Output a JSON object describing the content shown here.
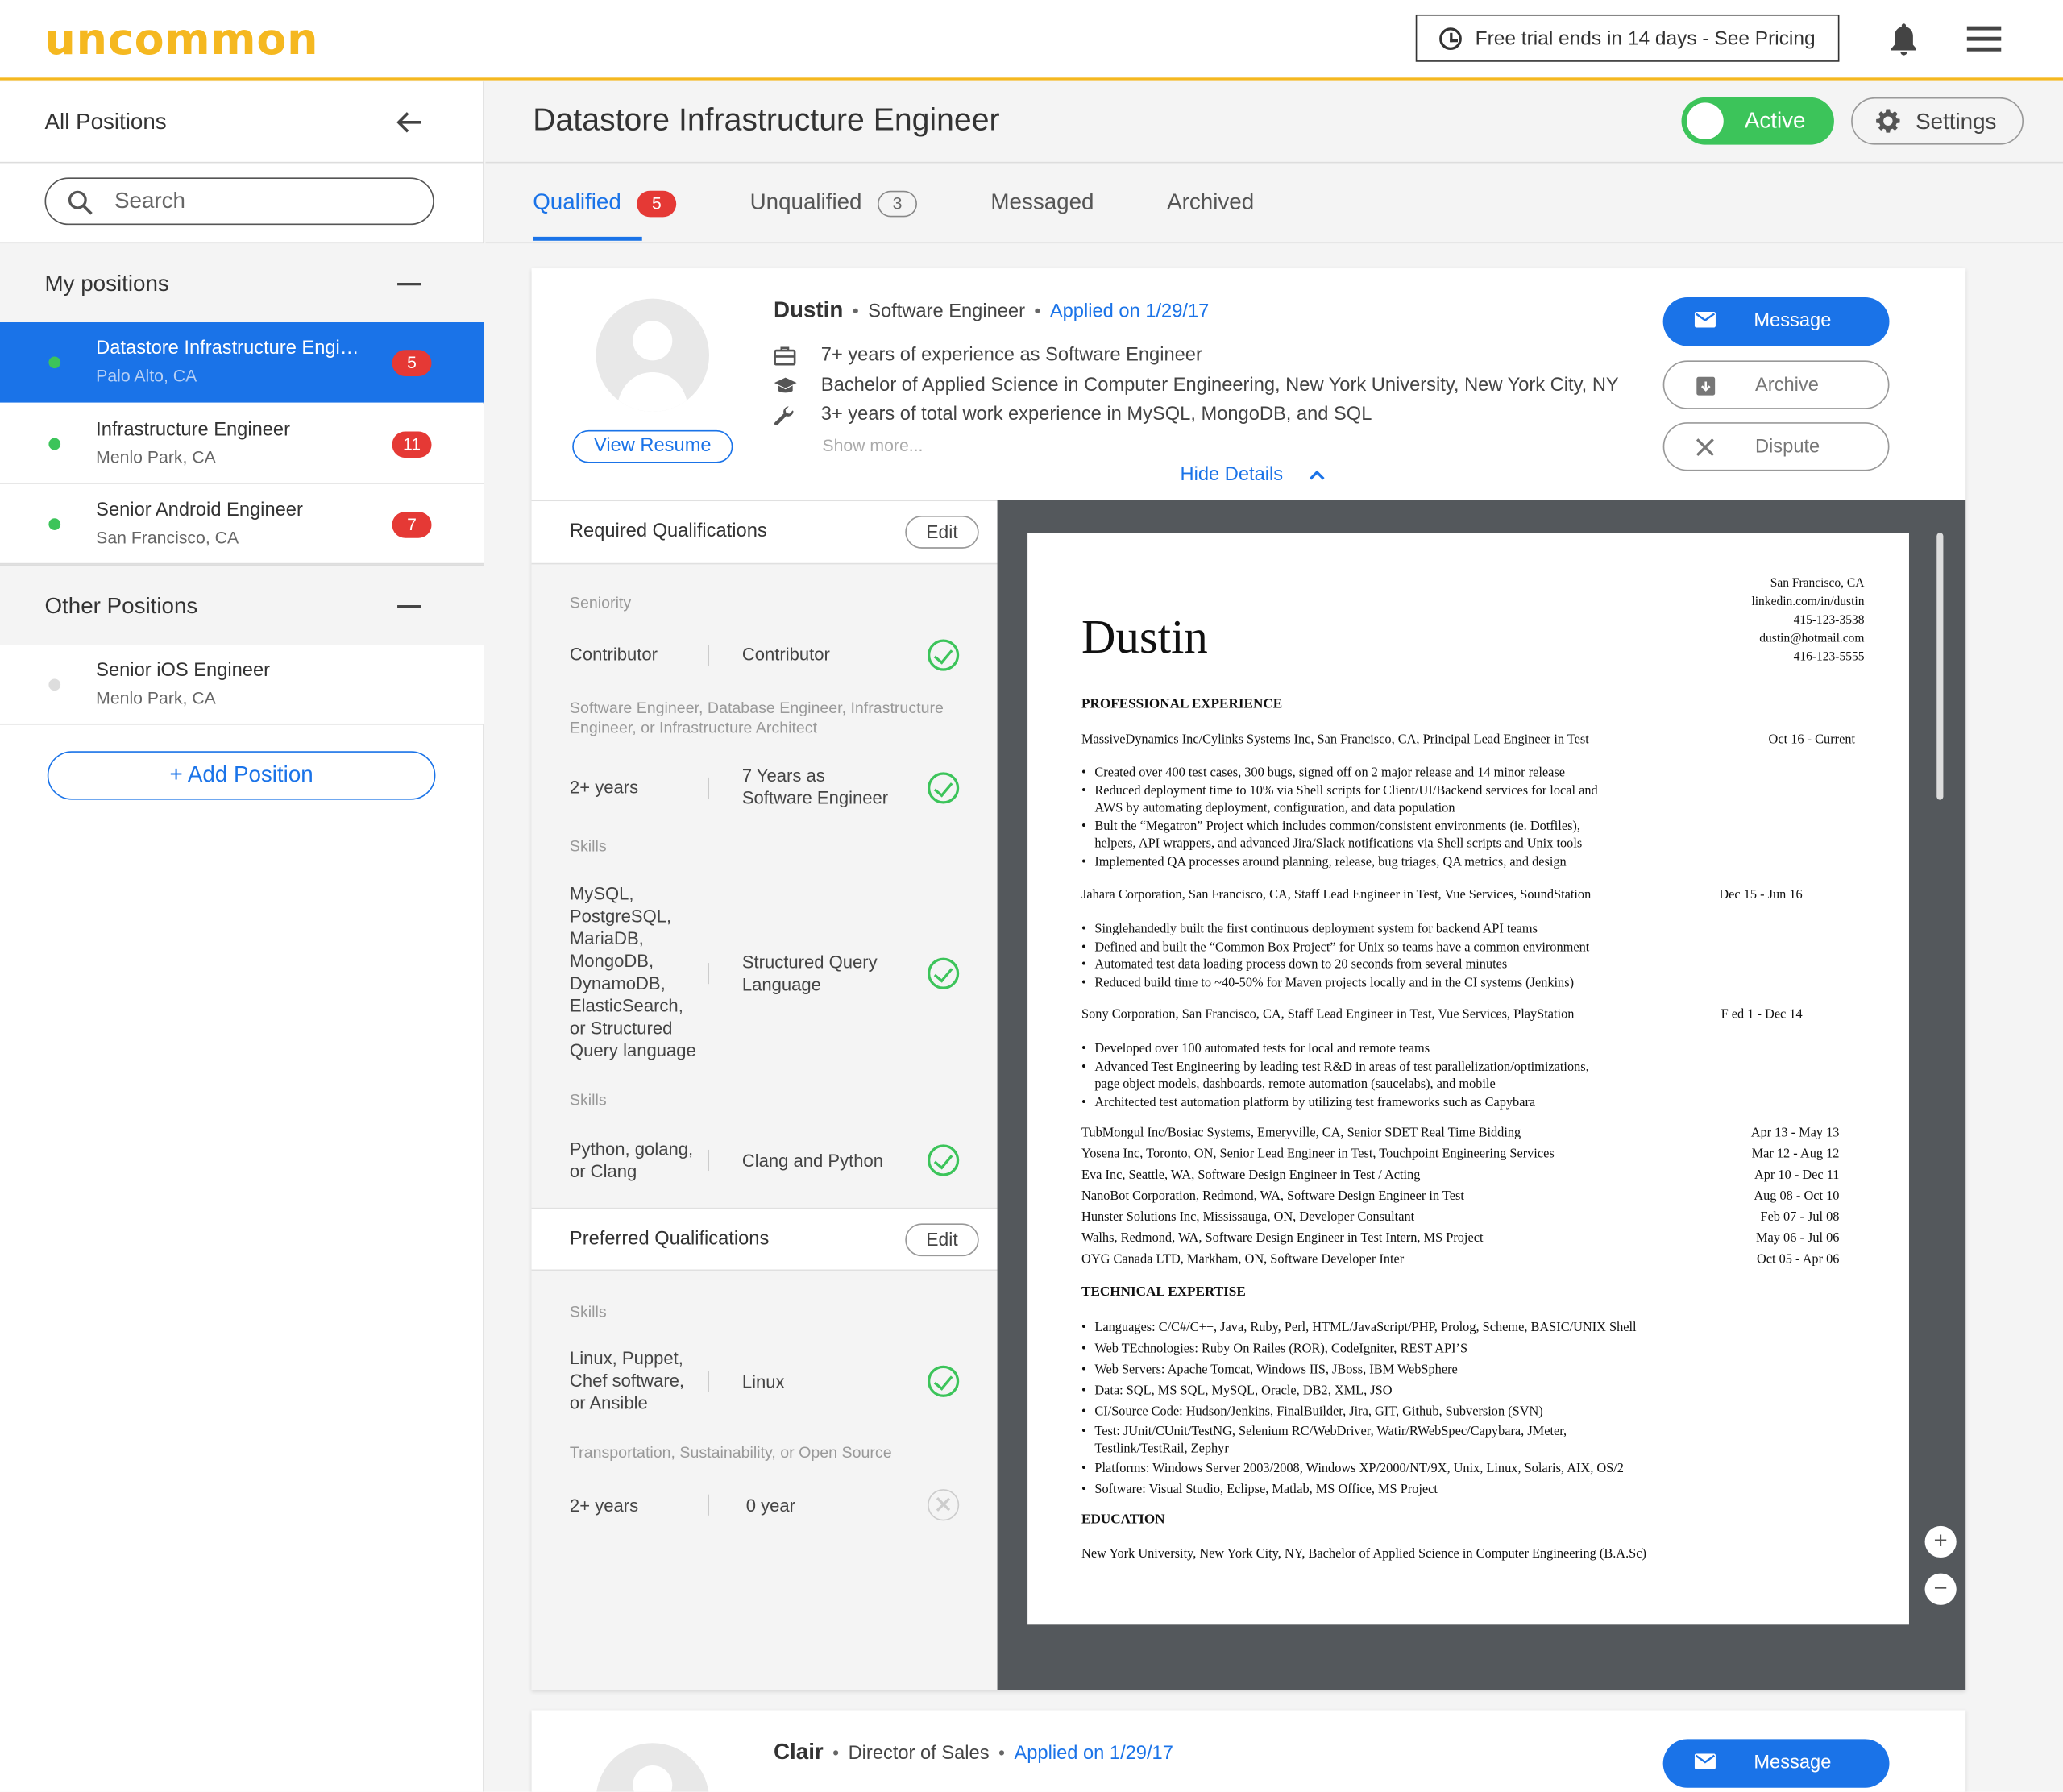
{
  "app": {
    "logo": "uncommon",
    "trial_text": "Free trial ends in 14 days - See Pricing",
    "accent_color": "#f5b820",
    "primary_color": "#1a73e8"
  },
  "sidebar": {
    "header": "All Positions",
    "search_placeholder": "Search",
    "my_positions_label": "My positions",
    "other_positions_label": "Other Positions",
    "my_positions": [
      {
        "name": "Datastore Infrastructure Engineer",
        "location": "Palo Alto, CA",
        "count": "5",
        "active": true
      },
      {
        "name": "Infrastructure Engineer",
        "location": "Menlo Park, CA",
        "count": "11",
        "active": true
      },
      {
        "name": "Senior Android Engineer",
        "location": "San Francisco, CA",
        "count": "7",
        "active": true
      }
    ],
    "other_positions": [
      {
        "name": "Senior iOS Engineer",
        "location": "Menlo Park, CA",
        "active": false
      }
    ],
    "add_position": "+ Add Position"
  },
  "main": {
    "title": "Datastore Infrastructure Engineer",
    "status_toggle": "Active",
    "settings_label": "Settings",
    "tabs": [
      {
        "label": "Qualified",
        "count": "5"
      },
      {
        "label": "Unqualified",
        "count": "3"
      },
      {
        "label": "Messaged"
      },
      {
        "label": "Archived"
      }
    ]
  },
  "candidate": {
    "name": "Dustin",
    "role": "Software Engineer",
    "applied": "Applied on 1/29/17",
    "view_resume": "View Resume",
    "details": [
      "7+ years of experience as Software Engineer",
      "Bachelor of Applied Science in Computer Engineering, New York University, New York City, NY",
      "3+ years of total work experience in MySQL, MongoDB, and SQL"
    ],
    "show_more": "Show more...",
    "hide_details": "Hide Details",
    "actions": {
      "message": "Message",
      "archive": "Archive",
      "dispute": "Dispute"
    }
  },
  "qualifications": {
    "required_title": "Required Qualifications",
    "preferred_title": "Preferred Qualifications",
    "edit_label": "Edit",
    "required": [
      {
        "label": "Seniority",
        "requirement": "Contributor",
        "candidate": "Contributor",
        "met": true
      },
      {
        "label": "Software Engineer, Database Engineer, Infrastructure Engineer, or Infrastructure Architect",
        "requirement": "2+ years",
        "candidate": "7 Years as Software Engineer",
        "met": true
      },
      {
        "label": "Skills",
        "requirement": "MySQL, PostgreSQL, MariaDB, MongoDB, DynamoDB, ElasticSearch, or Structured Query language",
        "candidate": "Structured Query Language",
        "met": true
      },
      {
        "label": "Skills",
        "requirement": "Python, golang, or Clang",
        "candidate": "Clang and Python",
        "met": true
      }
    ],
    "preferred": [
      {
        "label": "Skills",
        "requirement": "Linux, Puppet, Chef software, or Ansible",
        "candidate": "Linux",
        "met": true
      },
      {
        "label": "Transportation, Sustainability, or Open Source",
        "requirement": "2+ years",
        "candidate": "0 year",
        "met": false
      }
    ]
  },
  "resume": {
    "name": "Dustin",
    "contact": [
      "San Francisco, CA",
      "linkedin.com/in/dustin",
      "415-123-3538",
      "dustin@hotmail.com",
      "416-123-5555"
    ],
    "experience_title": "PROFESSIONAL EXPERIENCE",
    "jobs": [
      {
        "title": "MassiveDynamics Inc/Cylinks Systems Inc, San Francisco, CA, Principal Lead Engineer in Test",
        "dates": "Oct 16 - Current",
        "bullets": [
          "Created over 400 test cases, 300 bugs, signed off on 2 major release and 14 minor release",
          "Reduced deployment time to 10% via Shell scripts for Client/UI/Backend services for local and",
          "AWS by automating deployment, configuration, and data population",
          "Bult the “Megatron” Project which includes common/consistent environments (ie. Dotfiles),",
          "helpers, API wrappers, and advanced Jira/Slack notifications via Shell scripts and Unix tools",
          "Implemented QA processes around planning, release, bug triages, QA metrics, and design"
        ]
      },
      {
        "title": "Jahara Corporation, San Francisco, CA, Staff Lead Engineer in Test, Vue Services, SoundStation",
        "dates": "Dec 15 - Jun 16",
        "bullets": [
          "Singlehandedly built the first continuous deployment system for backend API teams",
          "Defined and built the “Common Box Project” for Unix so teams have a common environment",
          "Automated test data loading process down to 20 seconds from several minutes",
          "Reduced build time to ~40-50% for Maven projects locally and in the CI systems (Jenkins)"
        ]
      },
      {
        "title": "Sony Corporation, San Francisco, CA, Staff Lead Engineer in Test, Vue Services, PlayStation",
        "dates": "F ed 1 - Dec 14",
        "bullets": [
          "Developed over 100 automated tests for local and remote teams",
          "Advanced Test Engineering by leading test R&D in areas of test parallelization/optimizations,",
          "page object models, dashboards, remote automation (saucelabs), and mobile",
          "Architected test automation platform by utilizing test frameworks such as Capybara"
        ]
      }
    ],
    "other_jobs": [
      {
        "title": "TubMongul Inc/Bosiac Systems, Emeryville, CA, Senior SDET Real Time Bidding",
        "dates": "Apr 13 - May 13"
      },
      {
        "title": "Yosena Inc, Toronto, ON, Senior Lead Engineer in Test, Touchpoint Engineering Services",
        "dates": "Mar 12 - Aug 12"
      },
      {
        "title": "Eva Inc, Seattle, WA, Software Design Engineer in Test / Acting",
        "dates": "Apr 10 - Dec 11"
      },
      {
        "title": "NanoBot Corporation, Redmond, WA, Software Design Engineer in Test",
        "dates": "Aug 08 - Oct 10"
      },
      {
        "title": "Hunster Solutions Inc, Mississauga, ON, Developer Consultant",
        "dates": "Feb 07 - Jul 08"
      },
      {
        "title": "Walhs, Redmond, WA, Software Design Engineer in Test Intern, MS Project",
        "dates": "May 06 - Jul 06"
      },
      {
        "title": "OYG Canada LTD, Markham, ON, Software Developer Inter",
        "dates": "Oct 05 - Apr 06"
      }
    ],
    "technical_title": "TECHNICAL EXPERTISE",
    "technical": [
      "Languages: C/C#/C++, Java, Ruby, Perl, HTML/JavaScript/PHP, Prolog, Scheme, BASIC/UNIX Shell",
      "Web TEchnologies: Ruby On Railes (ROR), CodeIgniter, REST API’S",
      "Web Servers: Apache Tomcat, Windows IIS, JBoss, IBM WebSphere",
      "Data: SQL, MS SQL, MySQL, Oracle, DB2, XML, JSO",
      "CI/Source Code: Hudson/Jenkins, FinalBuilder, Jira, GIT, Github, Subversion (SVN)",
      "Test: JUnit/CUnit/TestNG, Selenium RC/WebDriver, Watir/RWebSpec/Capybara, JMeter,",
      "Testlink/TestRail, Zephyr",
      "Platforms: Windows Server 2003/2008, Windows XP/2000/NT/9X, Unix, Linux, Solaris, AIX, OS/2",
      "Software: Visual Studio, Eclipse, Matlab, MS Office, MS Project"
    ],
    "education_title": "EDUCATION",
    "education": "New York University, New York City, NY, Bachelor of Applied Science in Computer Engineering (B.A.Sc)",
    "zoom_in": "+",
    "zoom_out": "−"
  },
  "next_candidate": {
    "name": "Clair",
    "role": "Director of Sales",
    "applied": "Applied on 1/29/17",
    "message": "Message"
  }
}
